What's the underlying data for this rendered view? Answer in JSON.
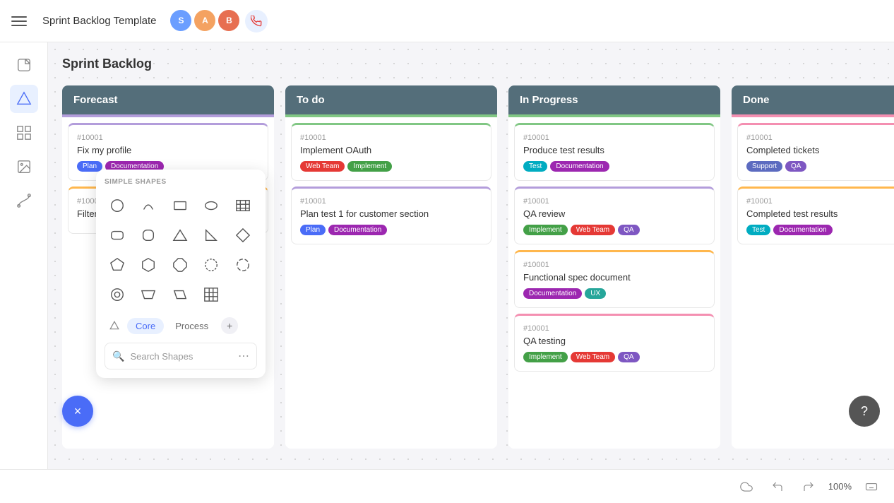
{
  "header": {
    "title": "Sprint Backlog Template",
    "menu_label": "menu"
  },
  "avatars": [
    {
      "label": "S",
      "color": "avatar-s"
    },
    {
      "label": "A",
      "color": "avatar-a"
    },
    {
      "label": "B",
      "color": "avatar-b"
    }
  ],
  "sprint": {
    "title": "Sprint Backlog"
  },
  "columns": [
    {
      "id": "forecast",
      "label": "Forecast",
      "color": "col-forecast",
      "cards": [
        {
          "id": "#10001",
          "title": "Fix my profile",
          "tags": [
            {
              "label": "Plan",
              "cls": "tag-plan"
            },
            {
              "label": "Documentation",
              "cls": "tag-docs"
            }
          ],
          "border": "card-purple"
        },
        {
          "id": "#10001",
          "title": "Filter service tickets",
          "tags": [],
          "border": "card-orange"
        }
      ]
    },
    {
      "id": "todo",
      "label": "To do",
      "color": "col-todo",
      "cards": [
        {
          "id": "#10001",
          "title": "Implement OAuth",
          "tags": [
            {
              "label": "Web Team",
              "cls": "tag-webteam"
            },
            {
              "label": "Implement",
              "cls": "tag-implement"
            }
          ],
          "border": "card-green"
        },
        {
          "id": "#10001",
          "title": "Plan test 1 for customer section",
          "tags": [
            {
              "label": "Plan",
              "cls": "tag-plan"
            },
            {
              "label": "Documentation",
              "cls": "tag-docs"
            }
          ],
          "border": "card-purple"
        }
      ]
    },
    {
      "id": "inprogress",
      "label": "In Progress",
      "color": "col-inprogress",
      "cards": [
        {
          "id": "#10001",
          "title": "Produce test results",
          "tags": [
            {
              "label": "Test",
              "cls": "tag-test"
            },
            {
              "label": "Documentation",
              "cls": "tag-docs"
            }
          ],
          "border": "card-green"
        },
        {
          "id": "#10001",
          "title": "QA review",
          "tags": [
            {
              "label": "Implement",
              "cls": "tag-implement"
            },
            {
              "label": "Web Team",
              "cls": "tag-webteam"
            },
            {
              "label": "QA",
              "cls": "tag-qa"
            }
          ],
          "border": "card-purple"
        },
        {
          "id": "#10001",
          "title": "Functional spec document",
          "tags": [
            {
              "label": "Documentation",
              "cls": "tag-docs"
            },
            {
              "label": "UX",
              "cls": "tag-ux"
            }
          ],
          "border": "card-orange"
        },
        {
          "id": "#10001",
          "title": "QA testing",
          "tags": [
            {
              "label": "Implement",
              "cls": "tag-implement"
            },
            {
              "label": "Web Team",
              "cls": "tag-webteam"
            },
            {
              "label": "QA",
              "cls": "tag-qa"
            }
          ],
          "border": "card-pink"
        }
      ]
    },
    {
      "id": "done",
      "label": "Done",
      "color": "col-done",
      "cards": [
        {
          "id": "#10001",
          "title": "Completed tickets",
          "tags": [
            {
              "label": "Support",
              "cls": "tag-support"
            },
            {
              "label": "QA",
              "cls": "tag-qa"
            }
          ],
          "border": "card-pink"
        },
        {
          "id": "#10001",
          "title": "Completed test results",
          "tags": [
            {
              "label": "Test",
              "cls": "tag-test"
            },
            {
              "label": "Documentation",
              "cls": "tag-docs"
            }
          ],
          "border": "card-orange"
        }
      ]
    }
  ],
  "shapes_panel": {
    "label": "SIMPLE SHAPES",
    "tabs": [
      {
        "label": "Core",
        "active": true
      },
      {
        "label": "Process",
        "active": false
      }
    ],
    "add_tab_label": "+",
    "search_placeholder": "Search Shapes"
  },
  "bottom": {
    "zoom": "100%"
  },
  "fab": {
    "label": "×"
  },
  "help": {
    "label": "?"
  }
}
